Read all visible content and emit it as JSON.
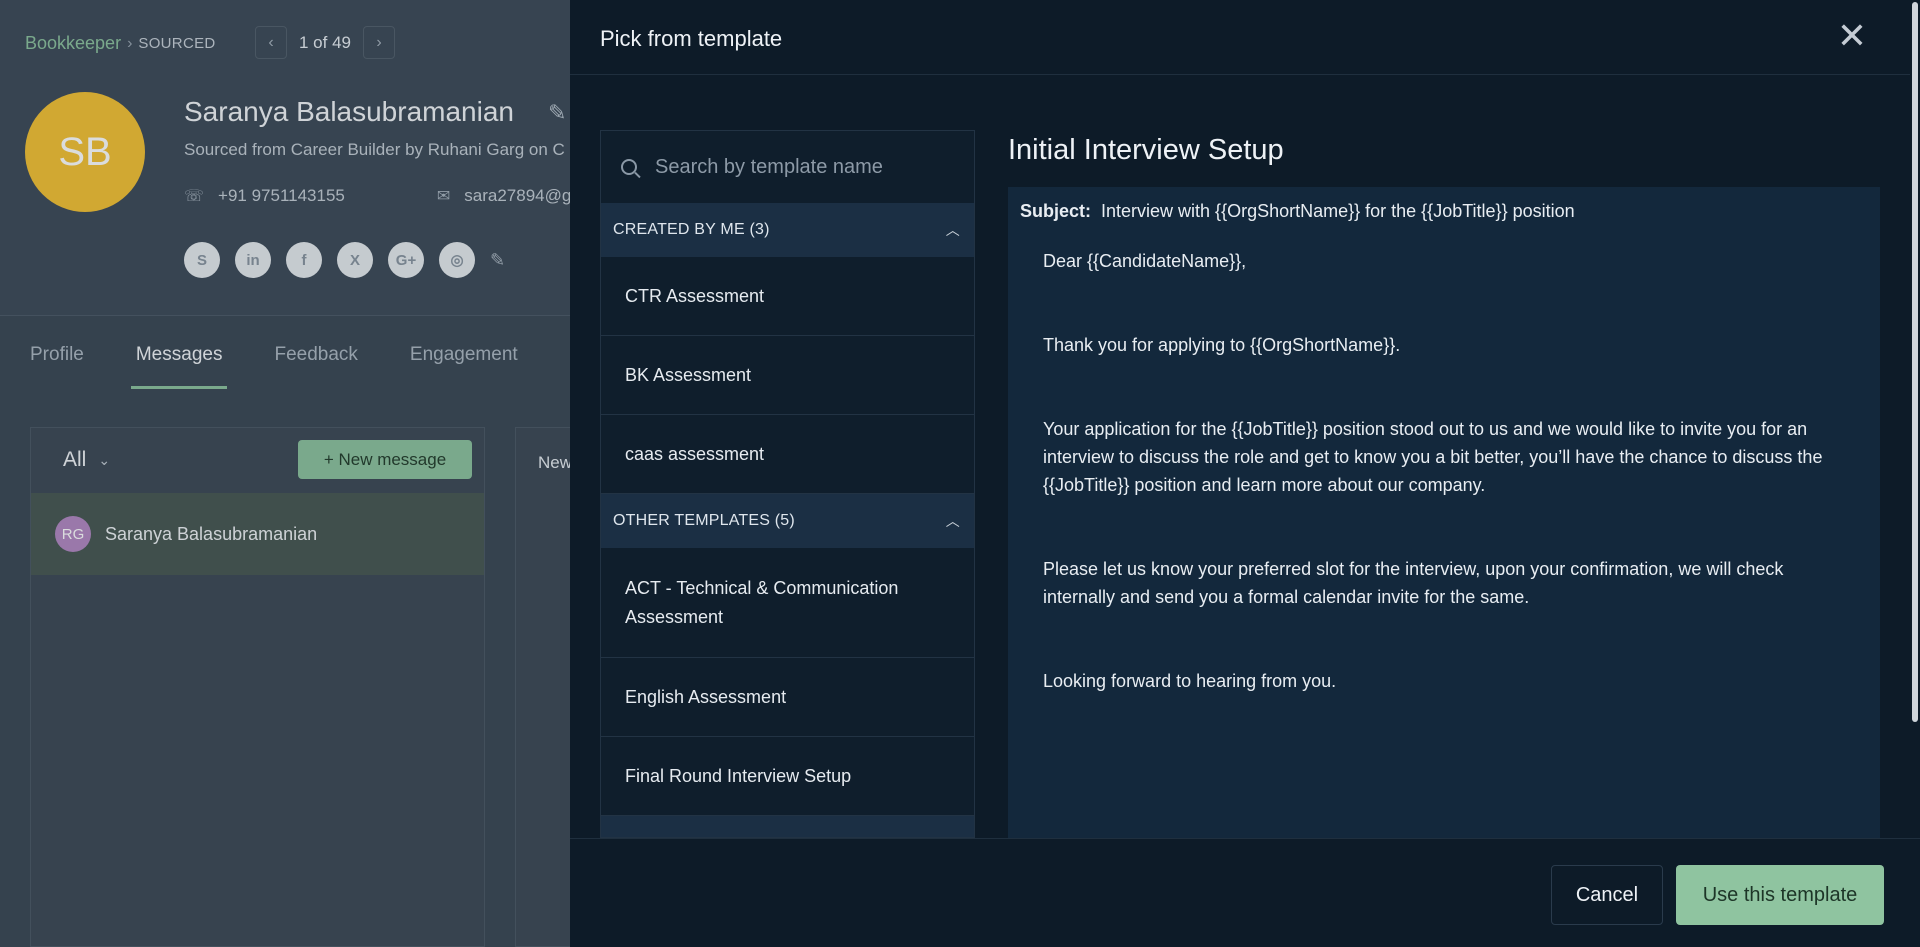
{
  "background": {
    "breadcrumb": {
      "link": "Bookkeeper",
      "separator": "›",
      "status": "SOURCED"
    },
    "pager": {
      "prev": "‹",
      "text": "1 of 49",
      "next": "›"
    },
    "candidate": {
      "initials": "SB",
      "name": "Saranya Balasubramanian",
      "source": "Sourced from Career Builder by Ruhani Garg on C",
      "phone": "+91 9751143155",
      "email": "sara27894@g"
    },
    "socials": [
      "S",
      "in",
      "f",
      "X",
      "G+",
      "◎"
    ],
    "tabs": [
      "Profile",
      "Messages",
      "Feedback",
      "Engagement"
    ],
    "messages": {
      "filter": "All",
      "new_message": "+ New message",
      "thread": {
        "initials": "RG",
        "name": "Saranya Balasubramanian"
      },
      "conversation_label": "New"
    },
    "accent_color": "#8fc4a0"
  },
  "drawer": {
    "title": "Pick from template",
    "close": "✕",
    "search_placeholder": "Search by template name",
    "groups": [
      {
        "label": "CREATED BY ME (3)",
        "items": [
          "CTR Assessment",
          "BK Assessment",
          "caas assessment"
        ]
      },
      {
        "label": "OTHER TEMPLATES (5)",
        "items": [
          "ACT - Technical & Communication Assessment",
          "English Assessment",
          "Final Round Interview Setup"
        ]
      }
    ],
    "preview": {
      "title": "Initial Interview Setup",
      "subject_label": "Subject:",
      "subject": "Interview with {{OrgShortName}} for the {{JobTitle}} position",
      "paragraphs": [
        "Dear {{CandidateName}},",
        "Thank you for applying to {{OrgShortName}}.",
        "Your application for the {{JobTitle}} position stood out to us and we would like to invite you for an interview to discuss the role and get to know you a bit better, you’ll have the chance to discuss the {{JobTitle}} position and learn more about our company.",
        "Please let us know your preferred slot for the interview, upon your confirmation, we will check internally and send you a formal calendar invite for the same.",
        "Looking forward to hearing from you."
      ]
    },
    "cancel": "Cancel",
    "use_template": "Use this template"
  }
}
